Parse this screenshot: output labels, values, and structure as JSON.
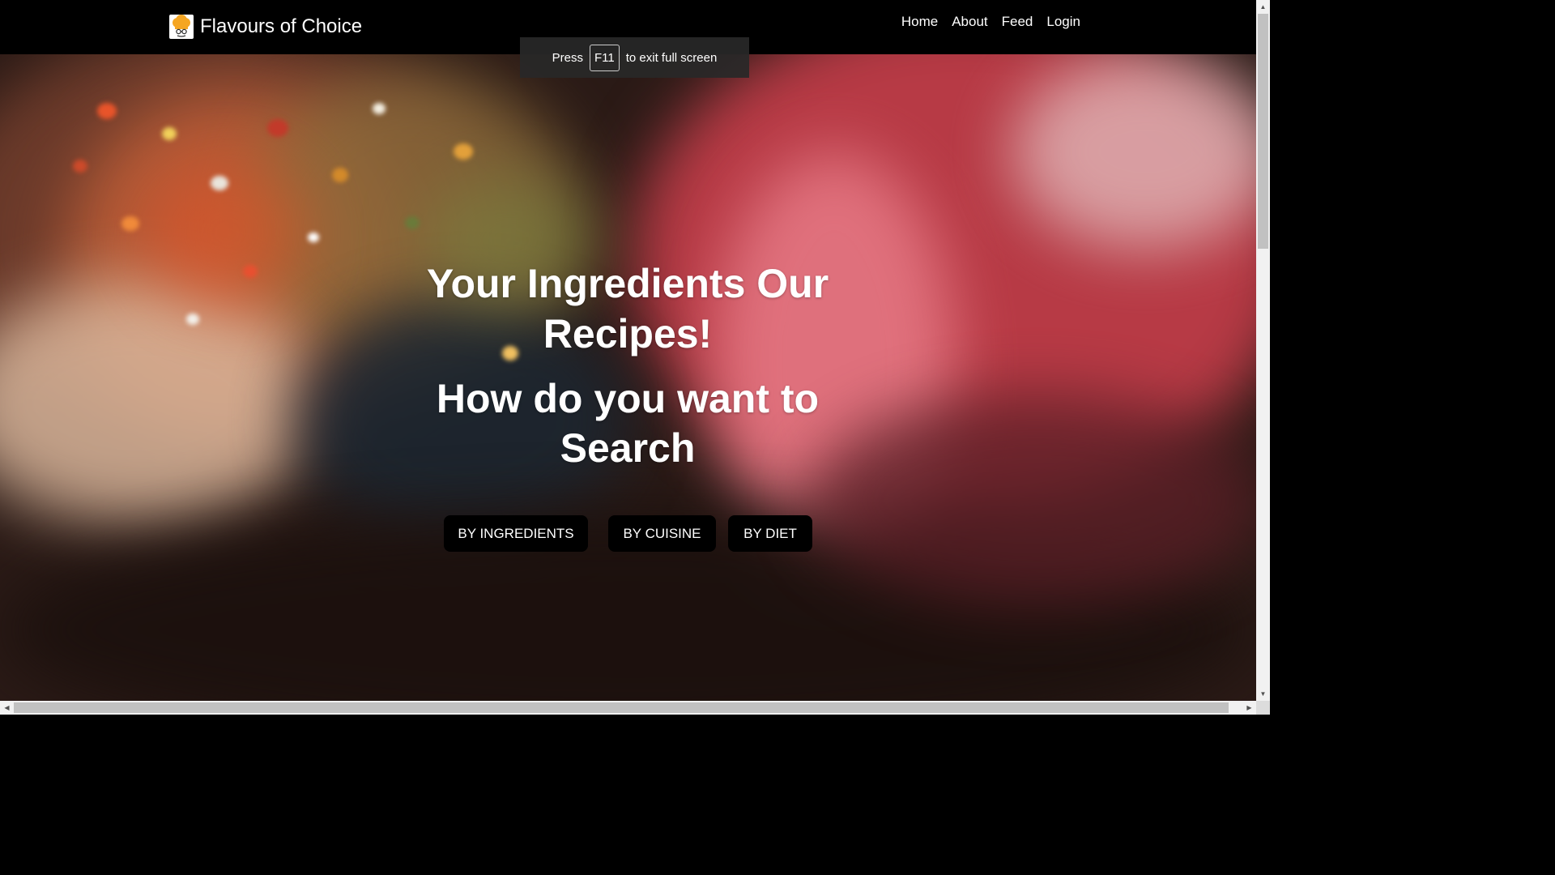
{
  "navbar": {
    "brand": "Flavours of Choice",
    "links": [
      "Home",
      "About",
      "Feed",
      "Login"
    ]
  },
  "fullscreen_toast": {
    "prefix": "Press",
    "key": "F11",
    "suffix": "to exit full screen"
  },
  "hero": {
    "title": "Your Ingredients Our Recipes!",
    "subtitle": "How do you want to Search",
    "buttons": [
      "BY INGREDIENTS",
      "BY CUISINE",
      "BY DIET"
    ]
  },
  "colors": {
    "navbar_bg": "#000000",
    "button_bg": "#000000",
    "text": "#ffffff",
    "logo_accent": "#f5a623"
  },
  "icons": {
    "logo": "chef-hat-icon",
    "scroll_up": "triangle-up-icon",
    "scroll_down": "triangle-down-icon",
    "scroll_left": "triangle-left-icon",
    "scroll_right": "triangle-right-icon"
  }
}
